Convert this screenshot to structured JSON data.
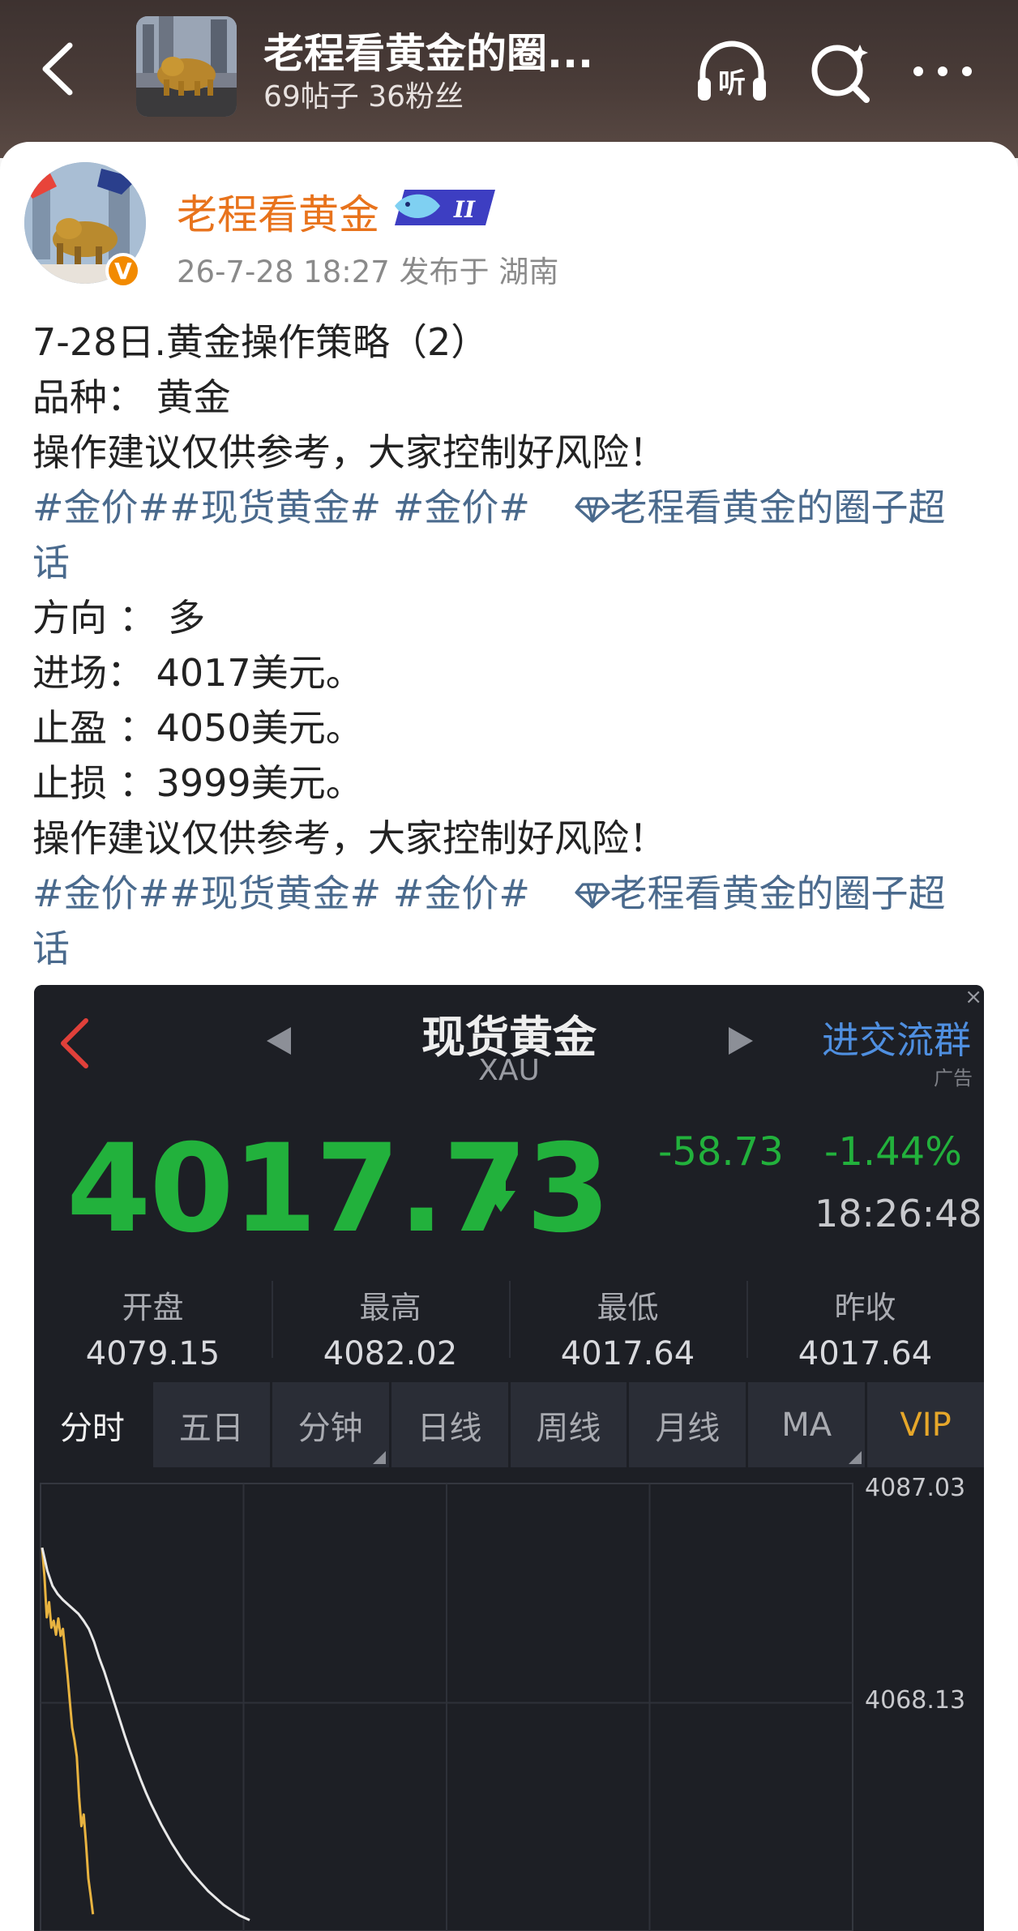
{
  "header": {
    "title": "老程看黄金的圈...",
    "subtitle": "69帖子 36粉丝",
    "icons": [
      "back-chevron-icon",
      "listen-headphones-icon",
      "search-icon",
      "more-icon"
    ],
    "listen_label": "听"
  },
  "post": {
    "author": "老程看黄金",
    "badge_text": "II",
    "verified_label": "V",
    "meta": "26-7-28 18:27  发布于 湖南",
    "lines": [
      {
        "text": "7-28日.黄金操作策略（2）"
      },
      {
        "text": "品种：  黄金"
      },
      {
        "text": "操作建议仅供参考，大家控制好风险！"
      },
      {
        "tags1": "#金价##现货黄金# #金价#",
        "supertopic": "老程看黄金的圈子超"
      },
      {
        "tag_cont": "话"
      },
      {
        "text": "方向 ： 多"
      },
      {
        "text": "进场：  4017美元。"
      },
      {
        "text": "止盈 ：4050美元。"
      },
      {
        "text": "止损 ：3999美元。"
      },
      {
        "text": "操作建议仅供参考，大家控制好风险！"
      },
      {
        "tags1": "#金价##现货黄金# #金价#",
        "supertopic": "老程看黄金的圈子超"
      },
      {
        "tag_cont": "话"
      }
    ]
  },
  "quote": {
    "title": "现货黄金",
    "symbol": "XAU",
    "ad_text": "进交流群",
    "ad_label": "广告",
    "close_glyph": "×",
    "price": "4017.73",
    "change": "-58.73",
    "change_pct": "-1.44%",
    "time": "18:26:48",
    "stats": [
      {
        "label": "开盘",
        "value": "4079.15"
      },
      {
        "label": "最高",
        "value": "4082.02"
      },
      {
        "label": "最低",
        "value": "4017.64"
      },
      {
        "label": "昨收",
        "value": "4017.64"
      }
    ],
    "tabs": [
      "分时",
      "五日",
      "分钟",
      "日线",
      "周线",
      "月线",
      "MA",
      "VIP"
    ],
    "colors": {
      "down": "#22b13c",
      "accent_link": "#4f8fe0",
      "vip": "#e6a72a",
      "author": "#e8731c",
      "topic": "#4a6a8d"
    }
  },
  "chart_data": {
    "type": "line",
    "y_tick_labels": [
      "4087.03",
      "4068.13"
    ],
    "ylim": [
      4049.23,
      4087.03
    ],
    "series": [
      {
        "x": [
          0,
          1,
          2,
          3,
          4,
          5,
          6,
          7,
          8,
          9,
          10,
          11,
          12,
          13,
          14,
          15,
          16,
          17,
          18,
          19,
          20,
          21,
          22
        ],
        "values": [
          4081.5,
          4079.0,
          4075.5,
          4076.8,
          4074.6,
          4075.2,
          4074.0,
          4075.4,
          4073.9,
          4074.5,
          4072.5,
          4070.5,
          4068.2,
          4066.0,
          4064.9,
          4063.5,
          4060.0,
          4057.5,
          4058.5,
          4056.0,
          4053.0,
          4051.5,
          4049.9
        ]
      },
      {
        "x": [
          0,
          1,
          2,
          3,
          4,
          5,
          6,
          7,
          8,
          9,
          10,
          11,
          12,
          13,
          14,
          15,
          16,
          17,
          18,
          19,
          20,
          21,
          22,
          23,
          24,
          25,
          26,
          27,
          28,
          29,
          30,
          31,
          32,
          33,
          34,
          35,
          36,
          37,
          38,
          39,
          40
        ],
        "values": [
          4081.5,
          4079.5,
          4078.2,
          4077.5,
          4077.0,
          4076.6,
          4076.2,
          4075.8,
          4075.2,
          4074.5,
          4073.4,
          4072.0,
          4070.8,
          4069.4,
          4068.0,
          4066.6,
          4065.2,
          4063.9,
          4062.7,
          4061.5,
          4060.4,
          4059.4,
          4058.5,
          4057.6,
          4056.8,
          4056.0,
          4055.3,
          4054.6,
          4054.0,
          4053.4,
          4052.9,
          4052.4,
          4051.9,
          4051.5,
          4051.1,
          4050.7,
          4050.4,
          4050.1,
          4049.8,
          4049.6,
          4049.4
        ]
      }
    ]
  }
}
